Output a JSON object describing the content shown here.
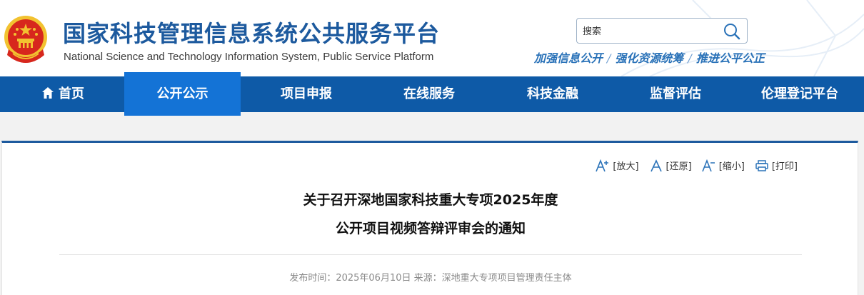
{
  "header": {
    "title": "国家科技管理信息系统公共服务平台",
    "subtitle": "National Science and Technology Information System, Public Service Platform",
    "search_placeholder": "搜索",
    "slogans": [
      "加强信息公开",
      "强化资源统筹",
      "推进公平公正"
    ],
    "slogan_separator": "/"
  },
  "nav": {
    "items": [
      "首页",
      "公开公示",
      "项目申报",
      "在线服务",
      "科技金融",
      "监督评估",
      "伦理登记平台"
    ],
    "active_index": 1
  },
  "tools": {
    "enlarge": "[放大]",
    "restore": "[还原]",
    "shrink": "[缩小]",
    "print": "[打印]"
  },
  "article": {
    "title_line1": "关于召开深地国家科技重大专项2025年度",
    "title_line2": "公开项目视频答辩评审会的通知",
    "publish_label": "发布时间：",
    "publish_date": "2025年06月10日",
    "source_label": "来源：",
    "source": "深地重大专项项目管理责任主体"
  },
  "colors": {
    "brand_blue": "#1d5a9e",
    "nav_bg": "#0e5aa7",
    "nav_active": "#1473d6",
    "emblem_red": "#d7271d",
    "emblem_gold": "#f2c230"
  }
}
